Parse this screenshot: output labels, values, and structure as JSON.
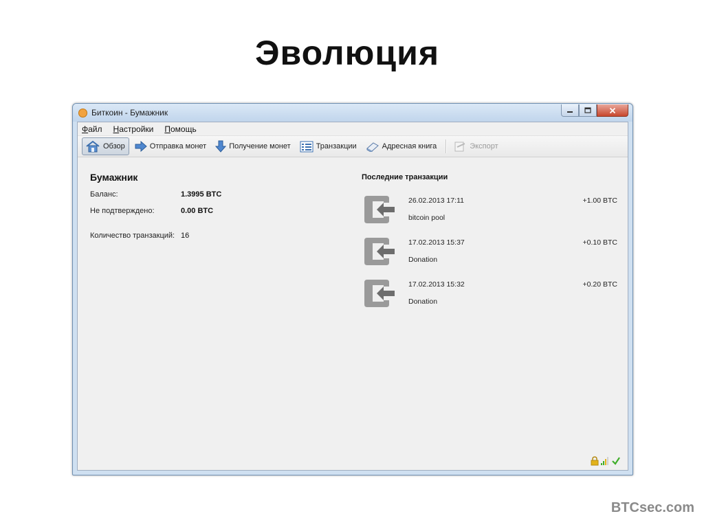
{
  "slide": {
    "title": "Эволюция",
    "watermark": "BTCsec.com"
  },
  "window": {
    "title": "Биткоин - Бумажник",
    "controls": {
      "minimize": "▭",
      "maximize": "▢",
      "close": "✕"
    }
  },
  "menu": [
    {
      "label": "Файл",
      "accel": "Ф",
      "rest": "айл"
    },
    {
      "label": "Настройки",
      "accel": "Н",
      "rest": "астройки"
    },
    {
      "label": "Помощь",
      "accel": "П",
      "rest": "омощь"
    }
  ],
  "toolbar": {
    "overview": "Обзор",
    "send": "Отправка монет",
    "receive": "Получение монет",
    "transactions": "Транзакции",
    "address_book": "Адресная книга",
    "export": "Экспорт"
  },
  "wallet": {
    "heading": "Бумажник",
    "balance_label": "Баланс:",
    "balance_value": "1.3995 BTC",
    "unconfirmed_label": "Не подтверждено:",
    "unconfirmed_value": "0.00 BTC",
    "tx_count_label": "Количество транзакций:",
    "tx_count_value": "16"
  },
  "recent": {
    "heading": "Последние транзакции",
    "items": [
      {
        "date": "26.02.2013 17:11",
        "description": "bitcoin pool",
        "amount": "+1.00 BTC"
      },
      {
        "date": "17.02.2013 15:37",
        "description": "Donation",
        "amount": "+0.10 BTC"
      },
      {
        "date": "17.02.2013 15:32",
        "description": "Donation",
        "amount": "+0.20 BTC"
      }
    ]
  },
  "colors": {
    "accent": "#6f8fb1",
    "incoming_icon": "#9a9a9a",
    "status_check": "#3fae2a",
    "status_lock": "#e2b21a"
  },
  "icons": {
    "overview": "house-icon",
    "send": "arrow-right-icon",
    "receive": "arrow-down-icon",
    "transactions": "list-icon",
    "address_book": "book-icon",
    "export": "export-icon",
    "transaction": "incoming-arrow-icon",
    "status": [
      "lock-icon",
      "signal-icon",
      "check-icon"
    ]
  }
}
